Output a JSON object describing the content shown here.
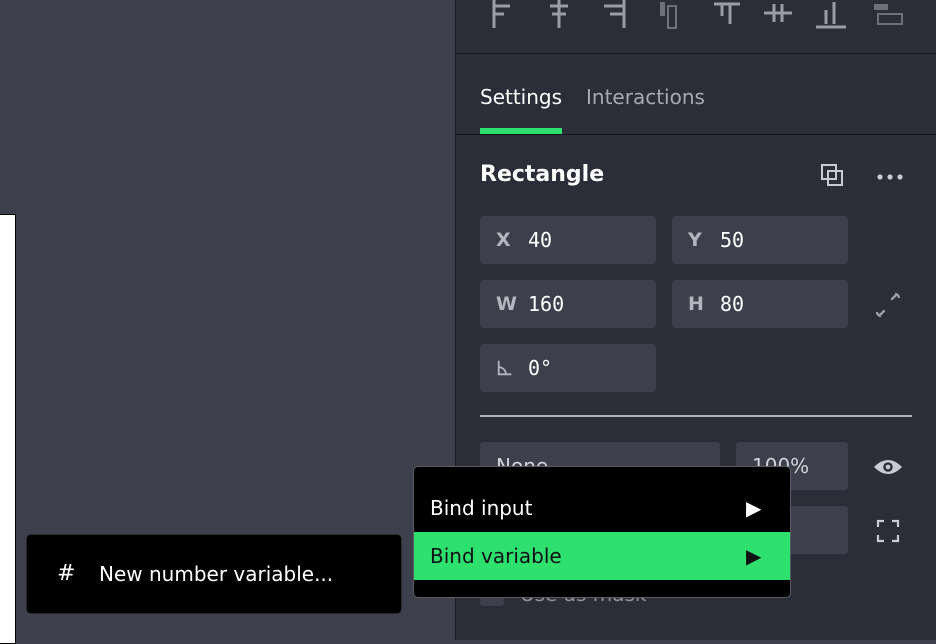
{
  "tabs": [
    {
      "label": "Settings"
    },
    {
      "label": "Interactions"
    }
  ],
  "layer": {
    "title": "Rectangle"
  },
  "geometry": {
    "x": {
      "label": "X",
      "value": "40"
    },
    "y": {
      "label": "Y",
      "value": "50"
    },
    "w": {
      "label": "W",
      "value": "160"
    },
    "h": {
      "label": "H",
      "value": "80"
    },
    "rotation": {
      "value": "0°"
    }
  },
  "appearance": {
    "blend_mode": "None",
    "opacity": "100%"
  },
  "mask": {
    "label": "Use as mask"
  },
  "context_menu": {
    "items": [
      {
        "label": "Bind input",
        "arrow": "▶"
      },
      {
        "label": "Bind variable",
        "arrow": "▶"
      }
    ]
  },
  "submenu": {
    "icon": "#",
    "label": "New number variable..."
  },
  "colors": {
    "accent": "#2ee06e",
    "panel_bg": "#2b2d38",
    "canvas_bg": "#3d404c",
    "field_bg": "#3d404c",
    "menu_bg": "#000000"
  },
  "icons": {
    "align": [
      "align-left-icon",
      "align-horizontal-center-icon",
      "align-right-icon",
      "align-top-icon",
      "align-vertical-center-icon",
      "align-bottom-icon",
      "distribute-icon"
    ],
    "duplicate": "duplicate-icon",
    "more": "more-icon",
    "link": "link-proportions-icon",
    "visibility": "eye-icon",
    "expand": "expand-icon",
    "rotation": "angle-icon"
  }
}
